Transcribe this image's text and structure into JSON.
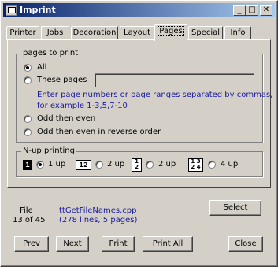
{
  "window": {
    "title": "Imprint"
  },
  "title_buttons": {
    "minimize": "_",
    "maximize": "□",
    "close": "✕"
  },
  "tabs": [
    "Printer",
    "Jobs",
    "Decoration",
    "Layout",
    "Pages",
    "Special",
    "Info"
  ],
  "pages_group": {
    "legend": "pages to print",
    "all": "All",
    "these_pages": "These pages",
    "these_pages_value": "",
    "hint_line1": "Enter page numbers or page ranges separated by commas,",
    "hint_line2": "for example 1-3,5,7-10",
    "odd_even": "Odd then even",
    "odd_even_reverse": "Odd then even in reverse order"
  },
  "nup_group": {
    "legend": "N-up printing",
    "icons": [
      "1",
      "12",
      "1\n2",
      "1 3\n2 4"
    ],
    "options": [
      "1 up",
      "2 up",
      "2 up",
      "4 up"
    ]
  },
  "file": {
    "label": "File",
    "count": "13 of 45",
    "name": "ttGetFileNames.cpp",
    "info": "(278 lines, 5 pages)"
  },
  "buttons": {
    "select": "Select",
    "prev": "Prev",
    "next": "Next",
    "print": "Print",
    "print_all": "Print All",
    "close": "Close"
  }
}
